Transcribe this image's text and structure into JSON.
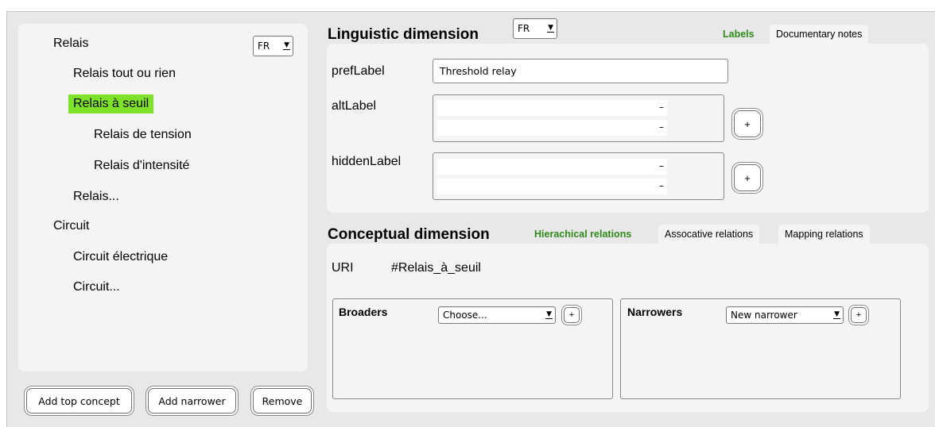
{
  "lang_selector": {
    "tree": "FR",
    "linguistic": "FR"
  },
  "tree": {
    "items": [
      {
        "label": "Relais"
      },
      {
        "label": "Relais tout ou rien"
      },
      {
        "label": "Relais à seuil"
      },
      {
        "label": "Relais de tension"
      },
      {
        "label": "Relais d'intensité"
      },
      {
        "label": "Relais..."
      },
      {
        "label": "Circuit"
      },
      {
        "label": "Circuit électrique"
      },
      {
        "label": "Circuit..."
      }
    ],
    "selected_index": 2
  },
  "tree_buttons": {
    "add_top": "Add top concept",
    "add_narrower": "Add narrower",
    "remove": "Remove"
  },
  "linguistic": {
    "title": "Linguistic dimension",
    "tabs": {
      "labels": "Labels",
      "notes": "Documentary notes"
    },
    "pref_label": "prefLabel",
    "pref_value": "Threshold relay",
    "alt_label": "altLabel",
    "hidden_label": "hiddenLabel",
    "minus": "–",
    "plus": "+"
  },
  "conceptual": {
    "title": "Conceptual dimension",
    "tabs": {
      "hierarchical": "Hierachical relations",
      "associative": "Assocative relations",
      "mapping": "Mapping relations"
    },
    "uri_label": "URI",
    "uri_value": "#Relais_à_seuil",
    "broaders": {
      "title": "Broaders",
      "select": "Choose..."
    },
    "narrowers": {
      "title": "Narrowers",
      "select": "New narrower"
    },
    "plus": "+"
  },
  "colors": {
    "selected_bg": "#7ee22a",
    "active_tab": "#2e8b1a",
    "frame_bg": "#e8e8e8",
    "panel_bg": "#f4f4f4"
  }
}
